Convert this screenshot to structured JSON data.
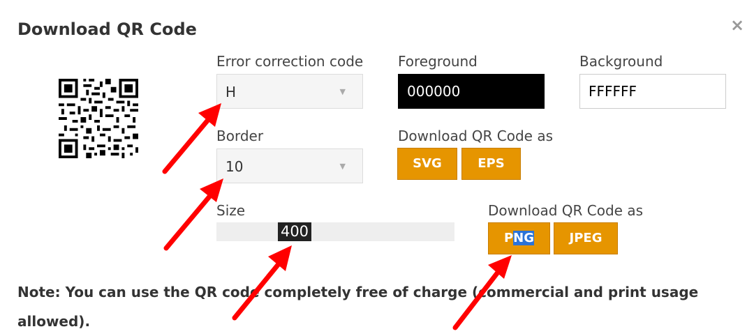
{
  "dialog": {
    "title": "Download QR Code",
    "close_label": "×"
  },
  "ecc": {
    "label": "Error correction code",
    "value": "H"
  },
  "foreground": {
    "label": "Foreground",
    "value": "000000",
    "color": "#000000"
  },
  "background": {
    "label": "Background",
    "value": "FFFFFF",
    "color": "#FFFFFF"
  },
  "border": {
    "label": "Border",
    "value": "10"
  },
  "download_vector": {
    "label": "Download QR Code as",
    "svg": "SVG",
    "eps": "EPS"
  },
  "size": {
    "label": "Size",
    "value": "400"
  },
  "download_raster": {
    "label": "Download QR Code as",
    "png_a": "P",
    "png_b": "NG",
    "jpeg": "JPEG"
  },
  "note": "Note: You can use the QR code completely free of charge (commercial and print usage allowed).",
  "colors": {
    "accent": "#E69500",
    "annotation_arrows": "#FF0000"
  }
}
